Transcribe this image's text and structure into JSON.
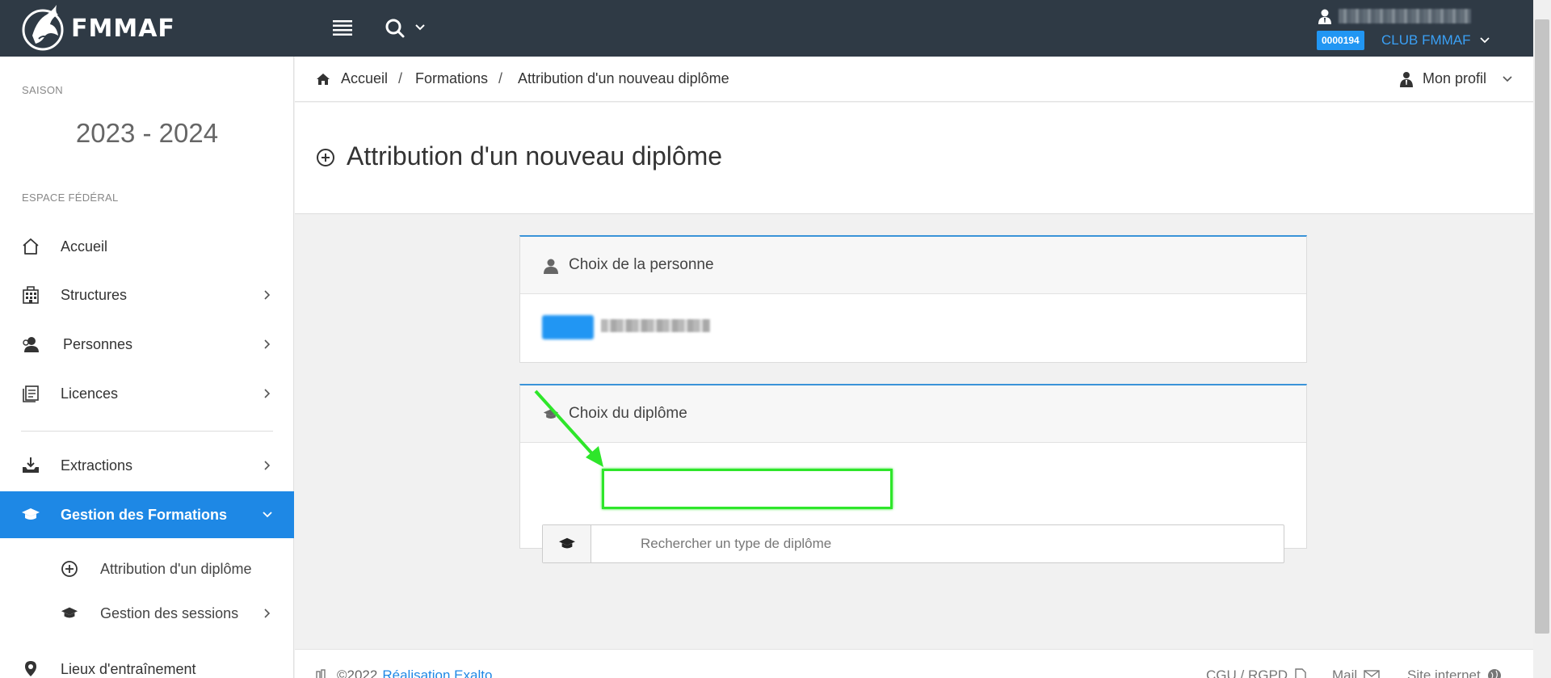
{
  "brand": {
    "name": "FMMAF"
  },
  "topbar": {
    "club_code": "0000194",
    "club_name": "CLUB FMMAF"
  },
  "sidebar": {
    "season_caption": "SAISON",
    "season": "2023 - 2024",
    "section_caption": "ESPACE FÉDÉRAL",
    "items": [
      {
        "label": "Accueil",
        "icon": "home-icon"
      },
      {
        "label": "Structures",
        "icon": "building-icon"
      },
      {
        "label": "Personnes",
        "icon": "people-icon"
      },
      {
        "label": "Licences",
        "icon": "license-icon"
      },
      {
        "label": "Extractions",
        "icon": "download-tray-icon"
      },
      {
        "label": "Gestion des Formations",
        "icon": "graduation-cap-icon"
      },
      {
        "label": "Lieux d'entraînement",
        "icon": "map-pin-icon"
      }
    ],
    "subitems": [
      {
        "label": "Attribution d'un diplôme",
        "icon": "plus-circle-icon"
      },
      {
        "label": "Gestion des sessions",
        "icon": "graduation-cap-icon"
      }
    ]
  },
  "breadcrumb": {
    "items": [
      "Accueil",
      "Formations",
      "Attribution d'un nouveau diplôme"
    ],
    "separator": "/"
  },
  "profile": {
    "label": "Mon profil"
  },
  "page": {
    "title": "Attribution d'un nouveau diplôme"
  },
  "person_panel": {
    "title": "Choix de la personne"
  },
  "diploma_panel": {
    "title": "Choix du diplôme",
    "search_placeholder": "Rechercher un type de diplôme",
    "search_value": ""
  },
  "footer": {
    "copyright": "©2022",
    "credit_link": "Réalisation Exalto",
    "cgu": "CGU / RGPD",
    "mail": "Mail",
    "site": "Site internet"
  },
  "colors": {
    "topbar": "#2f3a45",
    "accent": "#1e88e5",
    "highlight": "#2ee62a"
  }
}
